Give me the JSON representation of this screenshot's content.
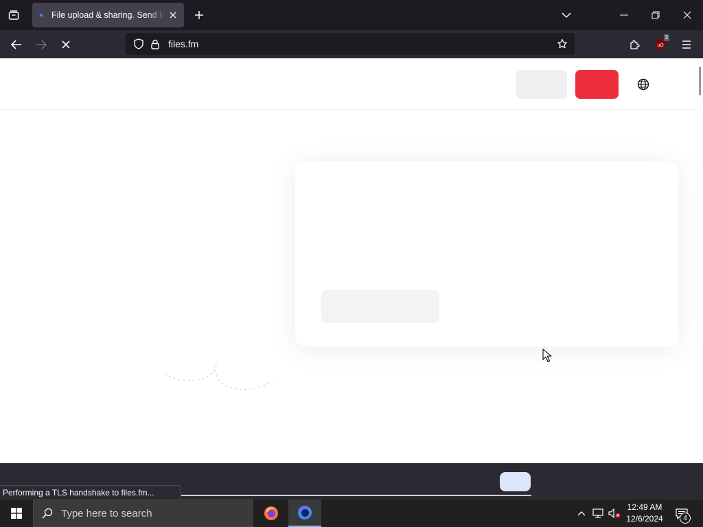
{
  "browser": {
    "tab": {
      "title": "File upload & sharing. Send large files"
    },
    "url": "files.fm",
    "extension_badge": "3"
  },
  "page": {
    "status_text": "Performing a TLS handshake to files.fm..."
  },
  "taskbar": {
    "search_placeholder": "Type here to search",
    "time": "12:49 AM",
    "date": "12/6/2024",
    "notification_count": "4"
  },
  "colors": {
    "primary_button": "#ee2e3c",
    "secondary_button": "#efefef",
    "accent_pill": "#dbe5fb"
  },
  "icons": [
    "tab-list-icon",
    "close-icon",
    "plus-icon",
    "chevron-down-icon",
    "minimize-icon",
    "restore-icon",
    "back-icon",
    "forward-icon",
    "stop-icon",
    "shield-icon",
    "lock-icon",
    "star-icon",
    "extensions-icon",
    "ublock-icon",
    "menu-icon",
    "globe-icon",
    "windows-start-icon",
    "search-icon",
    "firefox-icon",
    "firefox-dev-icon",
    "chevron-up-icon",
    "network-icon",
    "volume-muted-icon",
    "notification-icon"
  ]
}
